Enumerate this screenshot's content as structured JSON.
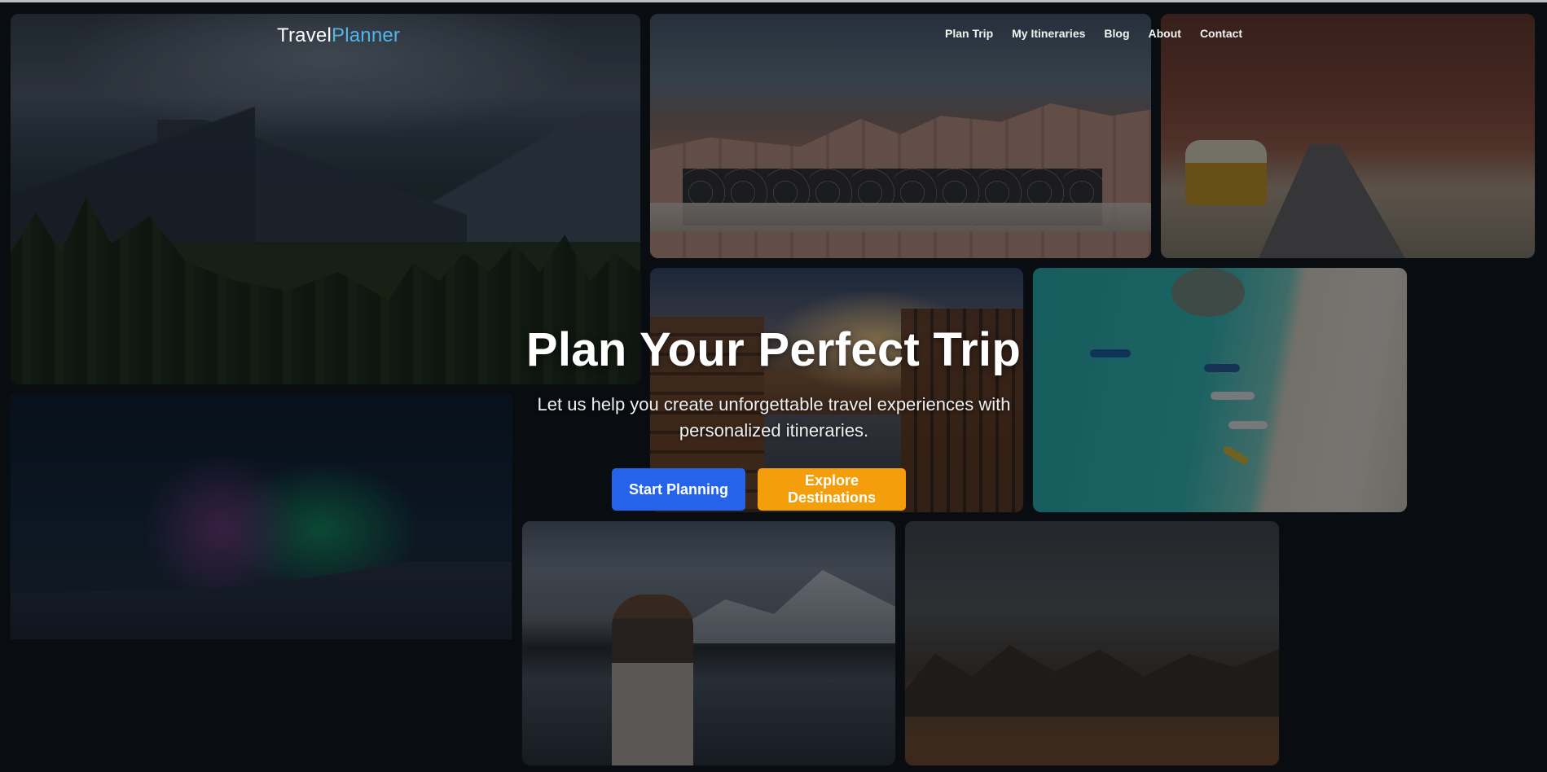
{
  "header": {
    "logo_part1": "Travel",
    "logo_part2": "Planner",
    "nav": [
      "Plan Trip",
      "My Itineraries",
      "Blog",
      "About",
      "Contact"
    ]
  },
  "hero": {
    "title": "Plan Your Perfect Trip",
    "subtitle": "Let us help you create unforgettable travel experiences with personalized itineraries.",
    "primary_button": "Start Planning",
    "secondary_button": "Explore Destinations"
  },
  "colors": {
    "background": "#0b0d12",
    "logo_accent": "#4fb6ea",
    "primary_button": "#2563eb",
    "secondary_button": "#f59e0b"
  },
  "gallery_icons": [
    "mountain-valley-photo",
    "venice-bridge-photo",
    "desert-van-photo",
    "aurora-photo",
    "kyoto-street-photo",
    "beach-aerial-photo",
    "lake-traveler-photo",
    "desert-canyon-photo"
  ]
}
